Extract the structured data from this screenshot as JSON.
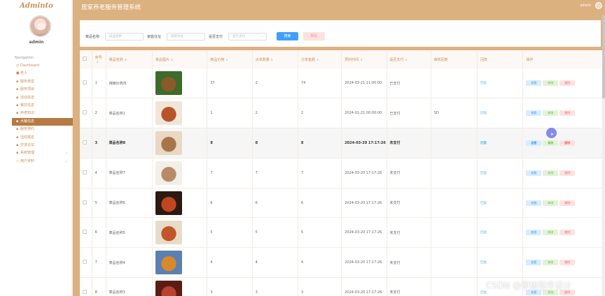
{
  "app": {
    "logo": "Adminto",
    "title": "居家养老服务管理系统",
    "header_user": "admin"
  },
  "sidebar": {
    "username": "admin",
    "nav_title": "Navigation",
    "items": [
      {
        "label": "Dashboard",
        "icon": "dashboard-icon",
        "glyph": "◷"
      },
      {
        "label": "老人",
        "icon": "user-icon",
        "glyph": "■"
      },
      {
        "label": "服务类型",
        "icon": "grid-icon",
        "glyph": "▪"
      },
      {
        "label": "服务项目",
        "icon": "grid-icon",
        "glyph": "▪"
      },
      {
        "label": "活动信息",
        "icon": "grid-icon",
        "glyph": "▪"
      },
      {
        "label": "餐饮信息",
        "icon": "grid-icon",
        "glyph": "▪"
      },
      {
        "label": "养老知识",
        "icon": "grid-icon",
        "glyph": "▪"
      },
      {
        "label": "点餐信息",
        "icon": "grid-icon",
        "glyph": "▪",
        "active": true
      },
      {
        "label": "服务预约",
        "icon": "grid-icon",
        "glyph": "▪"
      },
      {
        "label": "活动报名",
        "icon": "grid-icon",
        "glyph": "▪"
      },
      {
        "label": "交流论坛",
        "icon": "grid-icon",
        "glyph": "▪"
      },
      {
        "label": "系统管理",
        "icon": "grid-icon",
        "glyph": "▪",
        "chevron": true
      },
      {
        "label": "用户资料",
        "icon": "profile-icon",
        "glyph": "▭",
        "chevron": true
      }
    ]
  },
  "search": {
    "fields": [
      {
        "label": "菜品名称",
        "placeholder": "菜品名称"
      },
      {
        "label": "家庭住址",
        "placeholder": "家庭住址"
      },
      {
        "label": "是否支付",
        "placeholder": "是否支付",
        "select": true
      }
    ],
    "search_button": "搜索",
    "delete_button": "删除"
  },
  "table": {
    "columns": [
      "序号",
      "菜品名称",
      "菜品图片",
      "菜品价格",
      "点单数量",
      "订单金额",
      "预约时间",
      "是否支付",
      "审核回复",
      "回复",
      "操作"
    ],
    "rows": [
      {
        "idx": "1",
        "name": "辣椒炒肉鸡",
        "price": "37",
        "qty": "2",
        "amount": "74",
        "time": "2024-03-21 11:00:00",
        "paid": "已支付",
        "audit": "",
        "reply": "回复",
        "colors": [
          "#3d6b2a",
          "#8a5a2b"
        ]
      },
      {
        "idx": "2",
        "name": "菜品名称1",
        "price": "1",
        "qty": "2",
        "amount": "2",
        "time": "2024-01-21 00:00:00",
        "paid": "已支付",
        "audit": "SD",
        "reply": "回复",
        "colors": [
          "#efe6d8",
          "#b8532a"
        ]
      },
      {
        "idx": "3",
        "name": "菜品名称8",
        "price": "8",
        "qty": "8",
        "amount": "8",
        "time": "2024-03-20 17:17:26",
        "paid": "未支付",
        "audit": "",
        "reply": "回复",
        "colors": [
          "#e8d8c4",
          "#a8744a"
        ],
        "highlight": true
      },
      {
        "idx": "4",
        "name": "菜品名称7",
        "price": "7",
        "qty": "7",
        "amount": "7",
        "time": "2024-03-20 17:17:26",
        "paid": "未支付",
        "audit": "",
        "reply": "回复",
        "colors": [
          "#f2efe9",
          "#b98a66"
        ]
      },
      {
        "idx": "5",
        "name": "菜品名称6",
        "price": "6",
        "qty": "6",
        "amount": "6",
        "time": "2024-03-20 17:17:26",
        "paid": "未支付",
        "audit": "",
        "reply": "回复",
        "colors": [
          "#2a1a12",
          "#c1461f"
        ]
      },
      {
        "idx": "6",
        "name": "菜品名称5",
        "price": "5",
        "qty": "5",
        "amount": "5",
        "time": "2024-03-20 17:17:26",
        "paid": "未支付",
        "audit": "",
        "reply": "回复",
        "colors": [
          "#e6ddc9",
          "#c2552a"
        ]
      },
      {
        "idx": "7",
        "name": "菜品名称4",
        "price": "4",
        "qty": "4",
        "amount": "4",
        "time": "2024-03-20 17:17:26",
        "paid": "未支付",
        "audit": "",
        "reply": "回复",
        "colors": [
          "#5b7fb0",
          "#d88a2a"
        ]
      },
      {
        "idx": "8",
        "name": "菜品名称3",
        "price": "3",
        "qty": "3",
        "amount": "3",
        "time": "2024-03-20 17:17:26",
        "paid": "未支付",
        "audit": "",
        "reply": "回复",
        "colors": [
          "#5a1c14",
          "#b8432e"
        ]
      }
    ],
    "actions": {
      "view": "查看",
      "edit": "修改",
      "delete": "删除"
    }
  },
  "watermark": "CSDN @便捷程序设计"
}
